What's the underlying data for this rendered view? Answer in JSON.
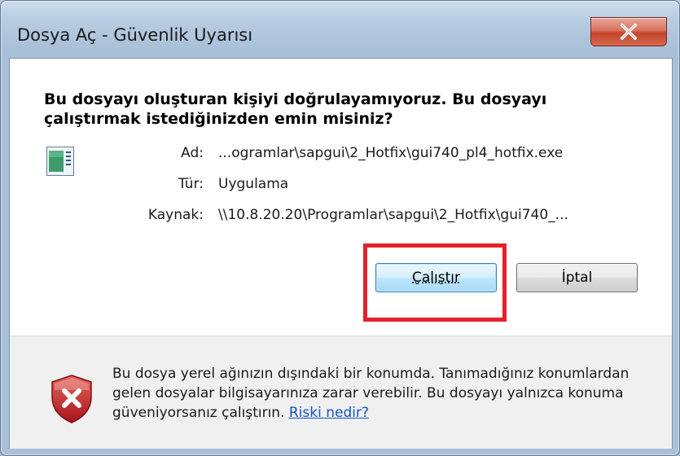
{
  "window": {
    "title": "Dosya Aç - Güvenlik Uyarısı",
    "close_label": "X"
  },
  "dialog": {
    "heading": "Bu dosyayı oluşturan kişiyi doğrulayamıyoruz. Bu dosyayı çalıştırmak istediğinizden emin misiniz?",
    "fields": [
      {
        "label": "Ad:",
        "value": "...ogramlar\\sapgui\\2_Hotfix\\gui740_pl4_hotfix.exe"
      },
      {
        "label": "Tür:",
        "value": "Uygulama"
      },
      {
        "label": "Kaynak:",
        "value": "\\\\10.8.20.20\\Programlar\\sapgui\\2_Hotfix\\gui740_..."
      }
    ],
    "run_button": "Çalıştır",
    "cancel_button": "İptal"
  },
  "warning": {
    "text": "Bu dosya yerel ağınızın dışındaki bir konumda. Tanımadığınız konumlardan gelen dosyalar bilgisayarınıza zarar verebilir. Bu dosyayı yalnızca konuma güveniyorsanız çalıştırın.",
    "link": "Riski nedir?"
  },
  "colors": {
    "highlight": "#e3222b",
    "link": "#1155cc",
    "shield": "#c8262b"
  },
  "icons": {
    "app": "application-icon",
    "shield": "security-shield-x-icon",
    "close": "close-icon"
  }
}
